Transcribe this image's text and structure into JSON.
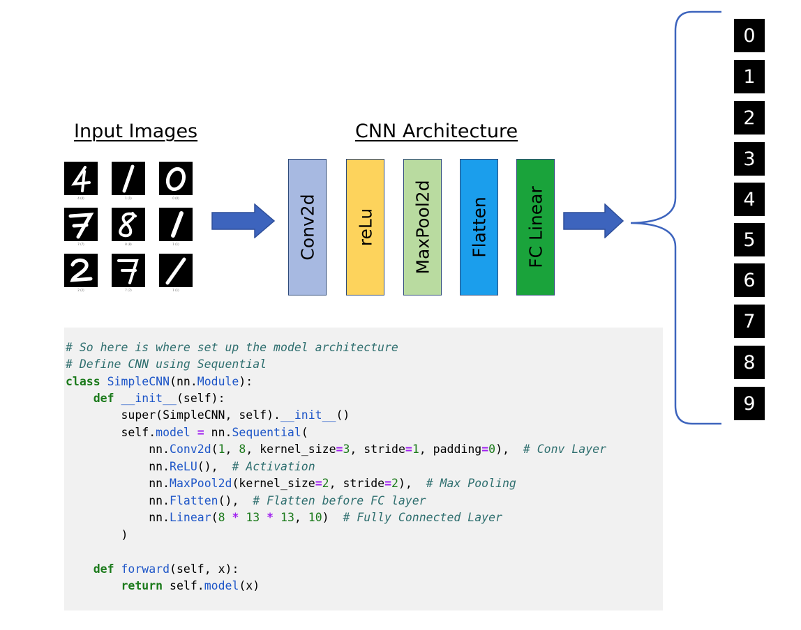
{
  "headings": {
    "input_images": "Input Images",
    "cnn_architecture": "CNN Architecture"
  },
  "digit_tiles": [
    {
      "digit": "4",
      "caption": "4 (4)"
    },
    {
      "digit": "1",
      "caption": "1 (1)"
    },
    {
      "digit": "0",
      "caption": "0 (0)"
    },
    {
      "digit": "7",
      "caption": "7 (7)"
    },
    {
      "digit": "8",
      "caption": "8 (8)"
    },
    {
      "digit": "1",
      "caption": "1 (1)"
    },
    {
      "digit": "2",
      "caption": "2 (2)"
    },
    {
      "digit": "7",
      "caption": "7 (7)"
    },
    {
      "digit": "1",
      "caption": "1 (1)"
    }
  ],
  "layers": [
    {
      "label": "Conv2d",
      "color": "#a7b9e1"
    },
    {
      "label": "reLu",
      "color": "#fdd35c"
    },
    {
      "label": "MaxPool2d",
      "color": "#b9dba0"
    },
    {
      "label": "Flatten",
      "color": "#1b9eec"
    },
    {
      "label": "FC Linear",
      "color": "#1aa33b"
    }
  ],
  "arrow_color": "#3d64bd",
  "brace_color": "#3d64bd",
  "output_classes": [
    "0",
    "1",
    "2",
    "3",
    "4",
    "5",
    "6",
    "7",
    "8",
    "9"
  ],
  "code": {
    "line1_comment": "# So here is where set up the model architecture",
    "line2_comment": "# Define CNN using Sequential",
    "line3_kw": "class",
    "line3_name": "SimpleCNN",
    "line3_mid": "(nn.",
    "line3_base": "Module",
    "line3_end": "):",
    "line4_kw": "def",
    "line4_name": "__init__",
    "line4_end": "(self):",
    "line5_start": "super(SimpleCNN, self).",
    "line5_name": "__init__",
    "line5_end": "()",
    "line6_start": "self.",
    "line6_attr": "model",
    "line6_op": "=",
    "line6_mid": "nn.",
    "line6_call": "Sequential",
    "line6_end": "(",
    "line7_start": "nn.",
    "line7_call": "Conv2d",
    "line7_text": "(1, 8, kernel_size=3, stride=1, padding=0),",
    "line7_comment": "# Conv Layer",
    "line8_start": "nn.",
    "line8_call": "ReLU",
    "line8_text": "(),",
    "line8_comment": "# Activation",
    "line9_start": "nn.",
    "line9_call": "MaxPool2d",
    "line9_text": "(kernel_size=2, stride=2),",
    "line9_comment": "# Max Pooling",
    "line10_start": "nn.",
    "line10_call": "Flatten",
    "line10_text": "(),",
    "line10_comment": "# Flatten before FC layer",
    "line11_start": "nn.",
    "line11_call": "Linear",
    "line11_text": "(8 * 13 * 13, 10)",
    "line11_comment": "# Fully Connected Layer",
    "line12_text": ")",
    "line13_kw": "def",
    "line13_name": "forward",
    "line13_end": "(self, x):",
    "line14_kw": "return",
    "line14_mid": "self.",
    "line14_attr": "model",
    "line14_end": "(x)"
  }
}
